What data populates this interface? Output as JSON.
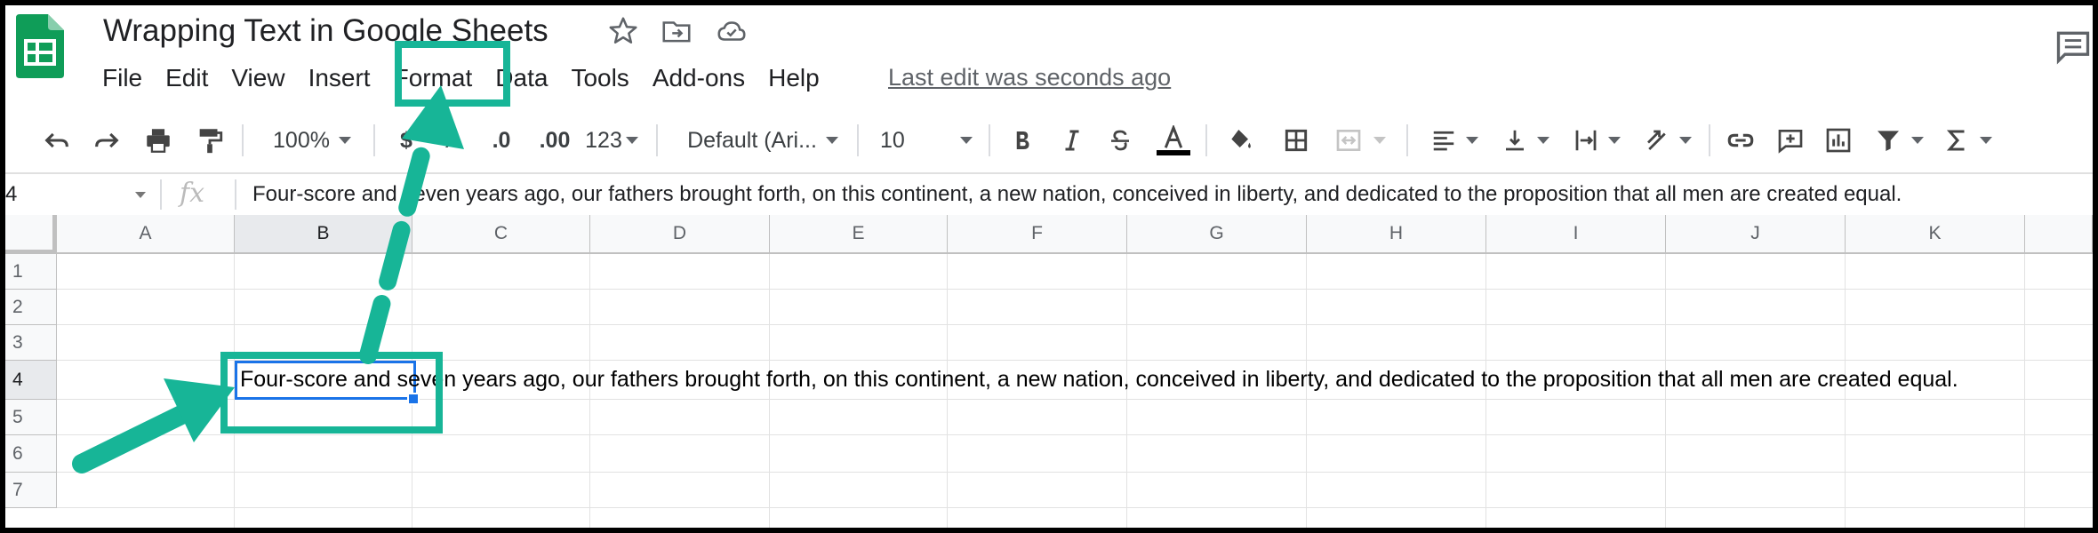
{
  "app": {
    "title": "Wrapping Text in Google Sheets",
    "last_edit": "Last edit was seconds ago",
    "colors": {
      "brand": "#0f9d58",
      "accent": "#1a73e8",
      "annotation": "#17b597"
    }
  },
  "title_icons": [
    "star-icon",
    "move-to-folder-icon",
    "cloud-saved-icon"
  ],
  "menu": [
    {
      "label": "File"
    },
    {
      "label": "Edit"
    },
    {
      "label": "View"
    },
    {
      "label": "Insert"
    },
    {
      "label": "Format"
    },
    {
      "label": "Data"
    },
    {
      "label": "Tools"
    },
    {
      "label": "Add-ons"
    },
    {
      "label": "Help"
    }
  ],
  "toolbar": {
    "zoom": "100%",
    "currency": "$",
    "percent": "%",
    "decrease_decimal": ".0",
    "increase_decimal": ".00",
    "more_formats": "123",
    "font": "Default (Ari...",
    "font_size": "10"
  },
  "formula_bar": {
    "cell_ref": "4",
    "fx": "fx",
    "content": "Four-score and seven years ago, our fathers brought forth, on this continent, a new nation, conceived in liberty, and dedicated to the proposition that all men are created equal."
  },
  "sheet": {
    "columns": [
      "A",
      "B",
      "C",
      "D",
      "E",
      "F",
      "G",
      "H",
      "I",
      "J",
      "K"
    ],
    "rows": [
      "1",
      "2",
      "3",
      "4",
      "5",
      "6",
      "7"
    ],
    "selected_column": "B",
    "selected_row": "4",
    "active_cell": {
      "ref": "B4",
      "text": "Four-score and seven years ago, our fathers brought forth, on this continent, a new nation, conceived in liberty, and dedicated to the proposition that all men are created equal."
    }
  }
}
